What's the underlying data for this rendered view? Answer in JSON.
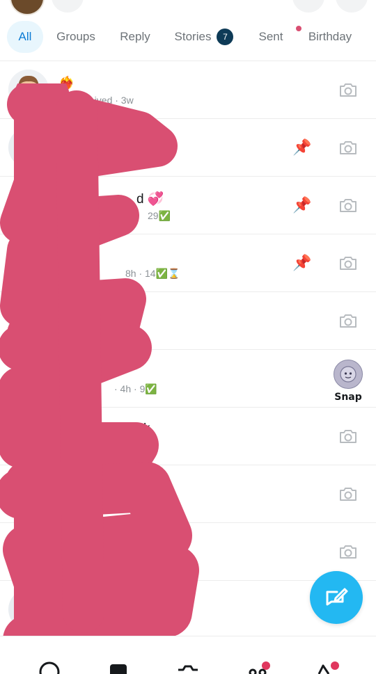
{
  "tabs": [
    {
      "label": "All",
      "active": true
    },
    {
      "label": "Groups"
    },
    {
      "label": "Reply"
    },
    {
      "label": "Stories",
      "badge": "7"
    },
    {
      "label": "Sent"
    },
    {
      "label": "Birthday",
      "dot": true
    }
  ],
  "chats": [
    {
      "name": "❤️‍🔥",
      "status_icon": "received-square",
      "status": "Received · 3w",
      "status_emoji": "😙",
      "action": "camera"
    },
    {
      "name": "",
      "status": "",
      "pinned": true,
      "action": "camera"
    },
    {
      "name": "d 💞",
      "status": "29✅",
      "pinned": true,
      "action": "camera"
    },
    {
      "name": "",
      "status": "8h · 14✅⌛",
      "status_emoji": "😊",
      "pinned": true,
      "action": "camera"
    },
    {
      "name": "",
      "status": "",
      "status_emoji": "😊",
      "action": "camera"
    },
    {
      "name": "",
      "status": "· 4h · 9✅",
      "action": "snap",
      "action_label": "Snap"
    },
    {
      "name": "k",
      "status": "",
      "action": "camera"
    },
    {
      "name": "",
      "status": "",
      "action": "camera"
    },
    {
      "name": "",
      "status": "",
      "action": "camera"
    },
    {
      "name": "",
      "status": "",
      "action": "camera"
    }
  ],
  "icons": {
    "pin": "📌",
    "camera": "camera-icon",
    "compose": "new-chat-icon"
  },
  "colors": {
    "accent": "#23b8f2",
    "active_tab_bg": "#e8f6fd",
    "active_tab_text": "#0a7bd4",
    "badge_bg": "#0e3b57",
    "notification_dot": "#e0375e",
    "scribble": "#d94f72"
  }
}
